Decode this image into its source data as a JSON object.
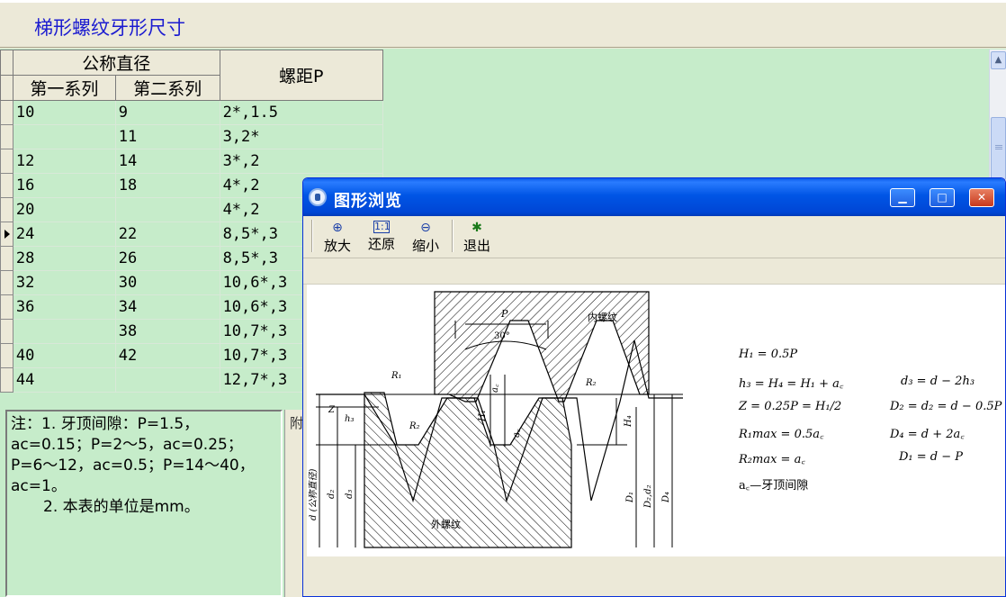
{
  "page": {
    "title": "梯形螺纹牙形尺寸"
  },
  "grid": {
    "header_group": "公称直径",
    "header_col1": "第一系列",
    "header_col2": "第二系列",
    "header_col3": "螺距P",
    "rows": [
      {
        "c1": "10",
        "c2": "9",
        "c3": "2*,1.5"
      },
      {
        "c1": "",
        "c2": "11",
        "c3": "3,2*"
      },
      {
        "c1": "12",
        "c2": "14",
        "c3": "3*,2"
      },
      {
        "c1": "16",
        "c2": "18",
        "c3": "4*,2"
      },
      {
        "c1": "20",
        "c2": "",
        "c3": "4*,2"
      },
      {
        "c1": "24",
        "c2": "22",
        "c3": "8,5*,3"
      },
      {
        "c1": "28",
        "c2": "26",
        "c3": "8,5*,3"
      },
      {
        "c1": "32",
        "c2": "30",
        "c3": "10,6*,3"
      },
      {
        "c1": "36",
        "c2": "34",
        "c3": "10,6*,3"
      },
      {
        "c1": "",
        "c2": "38",
        "c3": "10,7*,3"
      },
      {
        "c1": "40",
        "c2": "42",
        "c3": "10,7*,3"
      },
      {
        "c1": "44",
        "c2": "",
        "c3": "12,7*,3"
      }
    ],
    "current_row_index": 5
  },
  "note": {
    "line1": "注：1. 牙顶间隙：P=1.5，",
    "line2": "ac=0.15；P=2～5，ac=0.25；",
    "line3": "P=6～12，ac=0.5；P=14～40，",
    "line4": "ac=1。",
    "line5": "2. 本表的单位是mm。"
  },
  "side_panel": {
    "label": "附"
  },
  "dialog": {
    "title": "图形浏览",
    "toolbar": {
      "zoom_in": "放大",
      "restore": "还原",
      "zoom_out": "缩小",
      "exit": "退出"
    },
    "figure": {
      "label_P": "P",
      "label_angle": "30°",
      "label_internal": "内螺纹",
      "label_external": "外螺纹",
      "label_R1": "R₁",
      "label_R2": "R₂",
      "label_Z": "Z",
      "label_h3": "h₃",
      "label_H1": "H₁",
      "label_H4": "H₄",
      "label_ac": "a꜀",
      "label_d": "d (公称直径)",
      "label_d2": "d₂",
      "label_d3": "d₃",
      "label_D1": "D₁",
      "label_D2d2": "D₂,d₂",
      "label_D4": "D₄"
    },
    "formulas": {
      "f1": "H₁ = 0.5P",
      "f2": "h₃ = H₄ = H₁ + a꜀",
      "f3": "d₃ = d − 2h₃",
      "f4": "Z = 0.25P = H₁/2",
      "f5": "D₂ = d₂ = d − 0.5P",
      "f6": "R₁max = 0.5a꜀",
      "f7": "D₄ = d + 2a꜀",
      "f8": "R₂max = a꜀",
      "f9": "D₁ = d − P",
      "f10": "a꜀—牙顶间隙"
    }
  }
}
